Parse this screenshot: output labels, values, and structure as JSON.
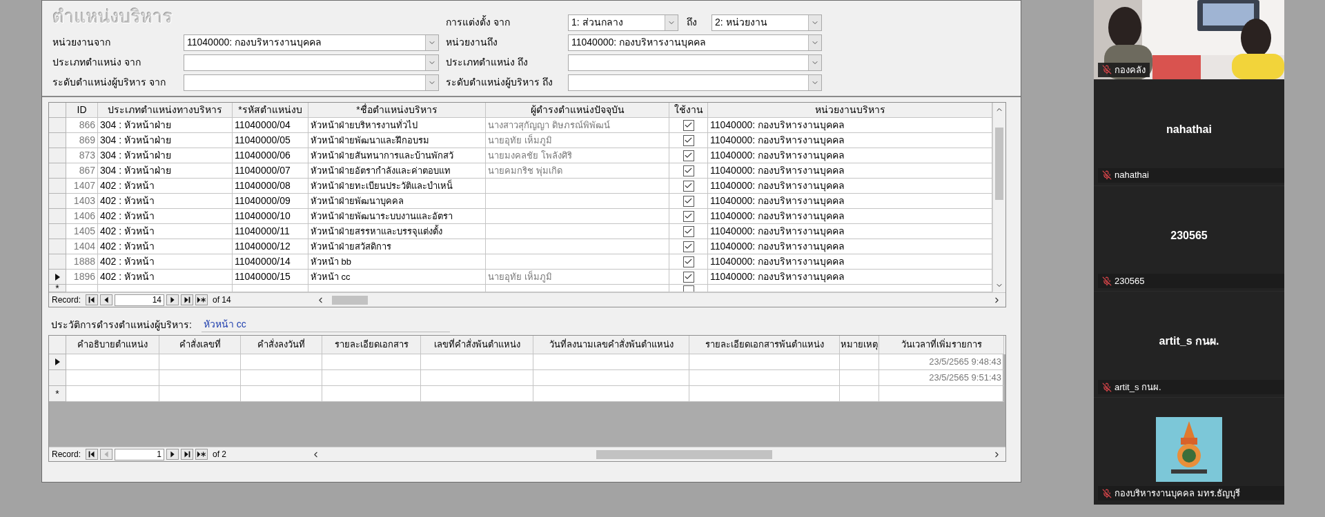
{
  "form": {
    "title": "ตำแหน่งบริหาร",
    "appointment": {
      "label": "การแต่งตั้ง จาก",
      "from": "1: ส่วนกลาง",
      "to_label": "ถึง",
      "to": "2: หน่วยงาน"
    },
    "filters": [
      {
        "from_label": "หน่วยงานจาก",
        "from_value": "11040000: กองบริหารงานบุคคล",
        "to_label": "หน่วยงานถึง",
        "to_value": "11040000: กองบริหารงานบุคคล"
      },
      {
        "from_label": "ประเภทตำแหน่ง จาก",
        "to_label": "ประเภทตำแหน่ง ถึง"
      },
      {
        "from_label": "ระดับตำแหน่งผู้บริหาร จาก",
        "to_label": "ระดับตำแหน่งผู้บริหาร ถึง"
      }
    ]
  },
  "table": {
    "columns": [
      "ID",
      "ประเภทตำแหน่งทางบริหาร",
      "*รหัสตำแหน่งบ",
      "*ชื่อตำแหน่งบริหาร",
      "ผู้ดำรงตำแหน่งปัจจุบัน",
      "ใช้งาน",
      "หน่วยงานบริหาร"
    ],
    "rows": [
      {
        "id": "866",
        "type": "304 : หัวหน้าฝ่าย",
        "code": "11040000/04",
        "name": "หัวหน้าฝ่ายบริหารงานทั่วไป",
        "holder": "นางสาวสุกัญญา ดิษภรณ์พิพัฒน์",
        "active": true,
        "unit": "11040000: กองบริหารงานบุคคล",
        "current": false
      },
      {
        "id": "869",
        "type": "304 : หัวหน้าฝ่าย",
        "code": "11040000/05",
        "name": "หัวหน้าฝ่ายพัฒนาและฝึกอบรม",
        "holder": "นายอุทัย เห็มภูมิ",
        "active": true,
        "unit": "11040000: กองบริหารงานบุคคล",
        "current": false
      },
      {
        "id": "873",
        "type": "304 : หัวหน้าฝ่าย",
        "code": "11040000/06",
        "name": "หัวหน้าฝ่ายสันทนาการและบ้านพักสวั",
        "holder": "นายมงคลชัย โพลังศิริ",
        "active": true,
        "unit": "11040000: กองบริหารงานบุคคล",
        "current": false
      },
      {
        "id": "867",
        "type": "304 : หัวหน้าฝ่าย",
        "code": "11040000/07",
        "name": "หัวหน้าฝ่ายอัตรากำลังและค่าตอบแท",
        "holder": "นายคมกริช พุ่มเกิด",
        "active": true,
        "unit": "11040000: กองบริหารงานบุคคล",
        "current": false
      },
      {
        "id": "1407",
        "type": "402 : หัวหน้า",
        "code": "11040000/08",
        "name": "หัวหน้าฝ่ายทะเบียนประวัติและบำเหน็",
        "active": true,
        "unit": "11040000: กองบริหารงานบุคคล",
        "current": false
      },
      {
        "id": "1403",
        "type": "402 : หัวหน้า",
        "code": "11040000/09",
        "name": "หัวหน้าฝ่ายพัฒนาบุคคล",
        "active": true,
        "unit": "11040000: กองบริหารงานบุคคล",
        "current": false
      },
      {
        "id": "1406",
        "type": "402 : หัวหน้า",
        "code": "11040000/10",
        "name": "หัวหน้าฝ่ายพัฒนาระบบงานและอัตรา",
        "active": true,
        "unit": "11040000: กองบริหารงานบุคคล",
        "current": false
      },
      {
        "id": "1405",
        "type": "402 : หัวหน้า",
        "code": "11040000/11",
        "name": "หัวหน้าฝ่ายสรรหาและบรรจุแต่งตั้ง",
        "active": true,
        "unit": "11040000: กองบริหารงานบุคคล",
        "current": false
      },
      {
        "id": "1404",
        "type": "402 : หัวหน้า",
        "code": "11040000/12",
        "name": "หัวหน้าฝ่ายสวัสดิการ",
        "active": true,
        "unit": "11040000: กองบริหารงานบุคคล",
        "current": false
      },
      {
        "id": "1888",
        "type": "402 : หัวหน้า",
        "code": "11040000/14",
        "name": "หัวหน้า bb",
        "active": true,
        "unit": "11040000: กองบริหารงานบุคคล",
        "current": false
      },
      {
        "id": "1896",
        "type": "402 : หัวหน้า",
        "code": "11040000/15",
        "name": "หัวหน้า cc",
        "holder": "นายอุทัย เห็มภูมิ",
        "active": true,
        "unit": "11040000: กองบริหารงานบุคคล",
        "current": true
      }
    ],
    "new_row": {
      "marker": "*",
      "active": false
    },
    "nav": {
      "label": "Record:",
      "current": "14",
      "total": "of 14"
    }
  },
  "history": {
    "label": "ประวัติการดำรงตำแหน่งผู้บริหาร:",
    "value": "หัวหน้า cc",
    "columns": [
      "คำอธิบายตำแหน่ง",
      "คำสั่งเลขที่",
      "คำสั่งลงวันที่",
      "รายละเอียดเอกสาร",
      "เลขที่คำสั่งพ้นตำแหน่ง",
      "วันที่ลงนามเลขคำสั่งพ้นตำแหน่ง",
      "รายละเอียดเอกสารพ้นตำแหน่ง",
      "หมายเหตุ",
      "วันเวลาที่เพิ่มรายการ"
    ],
    "rows": [
      {
        "added": "23/5/2565 9:48:43",
        "current": true
      },
      {
        "added": "23/5/2565 9:51:43",
        "current": false
      }
    ],
    "new_row": {
      "marker": "*"
    },
    "nav": {
      "label": "Record:",
      "current": "1",
      "total": "of 2"
    }
  },
  "participants": [
    {
      "kind": "video",
      "name": "กองคลัง",
      "muted": true
    },
    {
      "kind": "name",
      "display": "nahathai",
      "name": "nahathai",
      "muted": true
    },
    {
      "kind": "name",
      "display": "230565",
      "name": "230565",
      "muted": true
    },
    {
      "kind": "name",
      "display": "artit_s กนผ.",
      "name": "artit_s กนผ.",
      "muted": true
    },
    {
      "kind": "logo",
      "name": "กองบริหารงานบุคคล มทร.ธัญบุรี",
      "muted": true
    }
  ]
}
